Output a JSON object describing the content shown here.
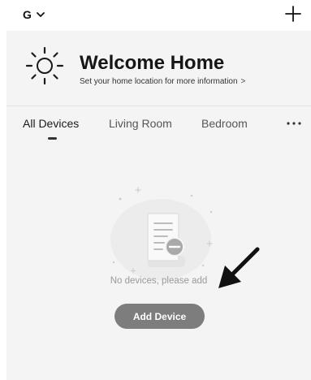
{
  "header": {
    "home_name": "G",
    "home_dropdown_icon": "chevron-down-icon",
    "add_icon": "plus-icon"
  },
  "welcome": {
    "icon": "sun-icon",
    "title": "Welcome Home",
    "subtitle": "Set your home location for more information",
    "subtitle_arrow": ">"
  },
  "tabs": [
    {
      "label": "All Devices",
      "active": true
    },
    {
      "label": "Living Room",
      "active": false
    },
    {
      "label": "Bedroom",
      "active": false
    }
  ],
  "tabs_more_icon": "more-dots-icon",
  "empty_state": {
    "illustration": "empty-device-list-icon",
    "message": "No devices, please add",
    "button_label": "Add Device"
  },
  "colors": {
    "background": "#ffffff",
    "panel": "#f4f4f4",
    "button": "#7d7d7d",
    "muted_text": "#9a9a9a"
  }
}
